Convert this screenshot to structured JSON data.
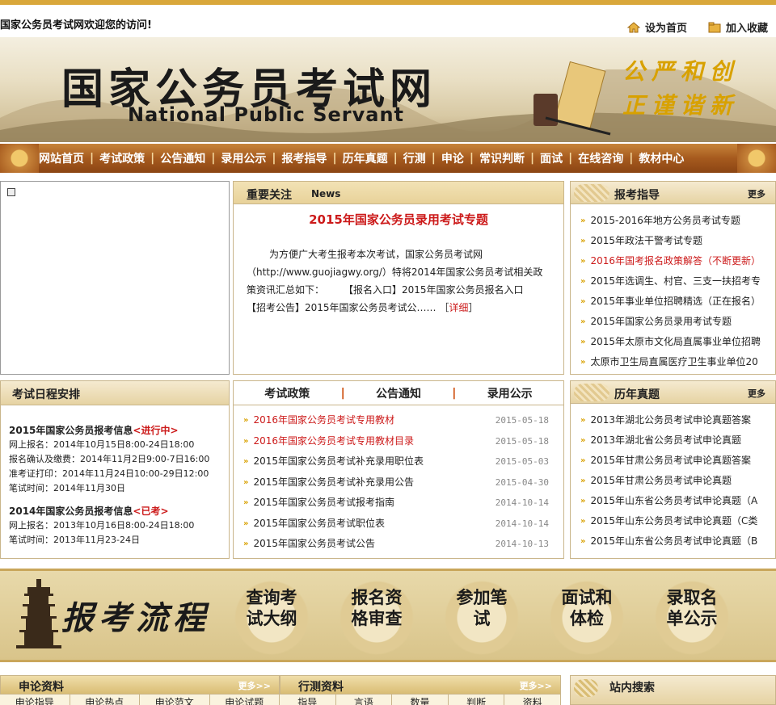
{
  "header": {
    "welcome": "国家公务员考试网欢迎您的访问!",
    "set_home": "设为首页",
    "add_fav": "加入收藏"
  },
  "banner": {
    "title_cn": "国家公务员考试网",
    "title_en": "National Public Servant",
    "motto": "公严和创正谨谐新"
  },
  "nav": {
    "items": [
      "网站首页",
      "考试政策",
      "公告通知",
      "录用公示",
      "报考指导",
      "历年真题",
      "行测",
      "申论",
      "常识判断",
      "面试",
      "在线咨询",
      "教材中心"
    ]
  },
  "news": {
    "label": "重要关注",
    "label_en": "News",
    "headline": "2015年国家公务员录用考试专题",
    "body": "为方便广大考生报考本次考试，国家公务员考试网（http://www.guojiagwy.org/）特将2014年国家公务员考试相关政策资讯汇总如下：　　　【报名入口】2015年国家公务员报名入口　　【招考公告】2015年国家公务员考试公……",
    "detail_pre": "［",
    "detail": "详细",
    "detail_post": "］"
  },
  "guide": {
    "title": "报考指导",
    "more": "更多",
    "items": [
      {
        "text": "2015-2016年地方公务员考试专题",
        "red": false
      },
      {
        "text": "2015年政法干警考试专题",
        "red": false
      },
      {
        "text": "2016年国考报名政策解答（不断更新）",
        "red": true
      },
      {
        "text": "2015年选调生、村官、三支一扶招考专",
        "red": false
      },
      {
        "text": "2015年事业单位招聘精选（正在报名）",
        "red": false
      },
      {
        "text": "2015年国家公务员录用考试专题",
        "red": false
      },
      {
        "text": "2015年太原市文化局直属事业单位招聘",
        "red": false
      },
      {
        "text": "太原市卫生局直属医疗卫生事业单位20",
        "red": false
      }
    ]
  },
  "schedule": {
    "title": "考试日程安排",
    "blocks": [
      {
        "title": "2015年国家公务员报考信息",
        "status": "<进行中>",
        "lines": [
          "网上报名：2014年10月15日8:00-24日18:00",
          "报名确认及缴费：2014年11月2日9:00-7日16:00",
          "准考证打印：2014年11月24日10:00-29日12:00",
          "笔试时间：2014年11月30日"
        ]
      },
      {
        "title": "2014年国家公务员报考信息",
        "status": "<已考>",
        "lines": [
          "网上报名：2013年10月16日8:00-24日18:00",
          "笔试时间：2013年11月23-24日"
        ]
      }
    ]
  },
  "policy": {
    "tabs": [
      "考试政策",
      "公告通知",
      "录用公示"
    ],
    "tab_sep": "|",
    "items": [
      {
        "text": "2016年国家公务员考试专用教材",
        "date": "2015-05-18",
        "red": true
      },
      {
        "text": "2016年国家公务员考试专用教材目录",
        "date": "2015-05-18",
        "red": true
      },
      {
        "text": "2015年国家公务员考试补充录用职位表",
        "date": "2015-05-03",
        "red": false
      },
      {
        "text": "2015年国家公务员考试补充录用公告",
        "date": "2015-04-30",
        "red": false
      },
      {
        "text": "2015年国家公务员考试报考指南",
        "date": "2014-10-14",
        "red": false
      },
      {
        "text": "2015年国家公务员考试职位表",
        "date": "2014-10-14",
        "red": false
      },
      {
        "text": "2015年国家公务员考试公告",
        "date": "2014-10-13",
        "red": false
      }
    ]
  },
  "papers": {
    "title": "历年真题",
    "more": "更多",
    "items": [
      "2013年湖北公务员考试申论真题答案",
      "2013年湖北省公务员考试申论真题",
      "2015年甘肃公务员考试申论真题答案",
      "2015年甘肃公务员考试申论真题",
      "2015年山东省公务员考试申论真题（A",
      "2015年山东公务员考试申论真题（C类",
      "2015年山东省公务员考试申论真题（B"
    ]
  },
  "flow": {
    "title": "报考流程",
    "steps": [
      "查询考试大纲",
      "报名资格审查",
      "参加笔试",
      "面试和体检",
      "录取名单公示"
    ]
  },
  "bottom": {
    "shenlun": {
      "title": "申论资料",
      "more": "更多>>",
      "tabs": [
        "申论指导",
        "申论热点",
        "申论范文",
        "申论试题"
      ]
    },
    "xingce": {
      "title": "行测资料",
      "more": "更多>>",
      "tabs": [
        "指导",
        "言语",
        "数量",
        "判断",
        "资料"
      ]
    },
    "search": {
      "title": "站内搜索"
    }
  },
  "colors": {
    "accent": "#d9a73a",
    "nav": "#a65a1e",
    "red": "#cc1a1a"
  }
}
